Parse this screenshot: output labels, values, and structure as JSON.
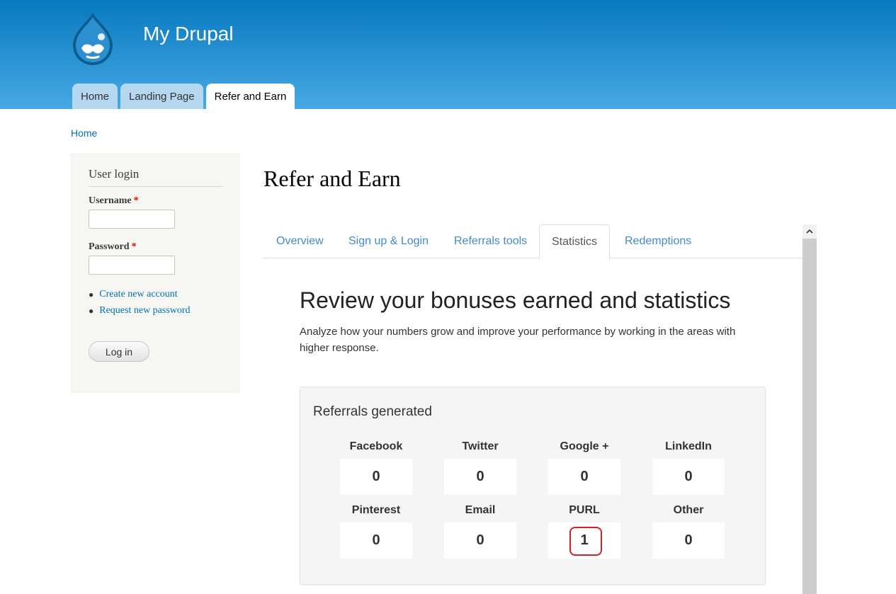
{
  "site": {
    "name": "My Drupal",
    "logo_icon": "drupal-drop-icon"
  },
  "main_menu": {
    "items": [
      {
        "label": "Home"
      },
      {
        "label": "Landing Page"
      },
      {
        "label": "Refer and Earn",
        "active": true
      }
    ]
  },
  "breadcrumb": {
    "home": "Home"
  },
  "sidebar": {
    "title": "User login",
    "username_label": "Username",
    "password_label": "Password",
    "required_mark": "*",
    "links": [
      "Create new account",
      "Request new password"
    ],
    "login_button": "Log in"
  },
  "page": {
    "title": "Refer and Earn"
  },
  "content_tabs": [
    {
      "label": "Overview"
    },
    {
      "label": "Sign up & Login"
    },
    {
      "label": "Referrals tools"
    },
    {
      "label": "Statistics",
      "active": true
    },
    {
      "label": "Redemptions"
    }
  ],
  "section": {
    "heading": "Review your bonuses earned and statistics",
    "description": "Analyze how your numbers grow and improve your performance by working in the areas with higher response."
  },
  "panel": {
    "title": "Referrals generated",
    "stats": [
      {
        "label": "Facebook",
        "value": "0"
      },
      {
        "label": "Twitter",
        "value": "0"
      },
      {
        "label": "Google +",
        "value": "0"
      },
      {
        "label": "LinkedIn",
        "value": "0"
      },
      {
        "label": "Pinterest",
        "value": "0"
      },
      {
        "label": "Email",
        "value": "0"
      },
      {
        "label": "PURL",
        "value": "1",
        "highlighted": true
      },
      {
        "label": "Other",
        "value": "0"
      }
    ]
  },
  "colors": {
    "header_top": "#0779bf",
    "header_bottom": "#48a9e4",
    "link": "#0071b3",
    "tab_link": "#428bca",
    "highlight": "#d0202a"
  }
}
